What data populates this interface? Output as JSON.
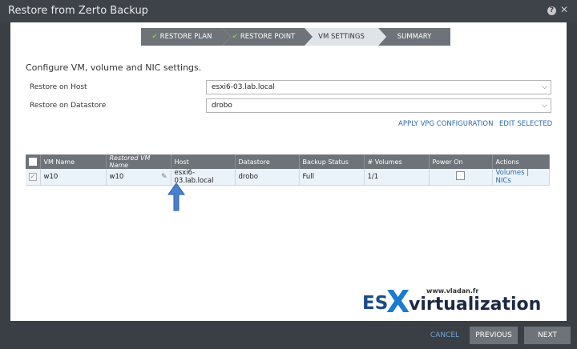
{
  "window": {
    "title": "Restore from Zerto Backup",
    "help_icon": "help-icon",
    "close_icon": "close-icon"
  },
  "wizard": {
    "steps": [
      {
        "label": "RESTORE PLAN",
        "state": "done"
      },
      {
        "label": "RESTORE POINT",
        "state": "done"
      },
      {
        "label": "VM SETTINGS",
        "state": "active"
      },
      {
        "label": "SUMMARY",
        "state": "todo"
      }
    ],
    "check_glyph": "✔"
  },
  "main": {
    "heading": "Configure VM, volume and NIC settings.",
    "restore_host_label": "Restore on Host",
    "restore_host_value": "esxi6-03.lab.local",
    "restore_datastore_label": "Restore on Datastore",
    "restore_datastore_value": "drobo",
    "apply_vpg_label": "APPLY VPG CONFIGURATION",
    "edit_selected_label": "EDIT SELECTED"
  },
  "table": {
    "columns": [
      "VM Name",
      "Restored VM Name",
      "Host",
      "Datastore",
      "Backup Status",
      "# Volumes",
      "Power On",
      "Actions"
    ],
    "rows": [
      {
        "vm_name": "w10",
        "restored_vm_name": "w10",
        "host": "esxi6-03.lab.local",
        "datastore": "drobo",
        "backup_status": "Full",
        "volumes": "1/1",
        "power_on": false,
        "action_volumes": "Volumes",
        "action_separator": "|",
        "action_nics": "NICs",
        "selected": true
      }
    ]
  },
  "footer": {
    "cancel_label": "CANCEL",
    "previous_label": "PREVIOUS",
    "next_label": "NEXT"
  },
  "watermark": {
    "url": "www.vladan.fr",
    "brand_es": "ES",
    "brand_x": "X",
    "brand_rest": "virtualization"
  },
  "colors": {
    "accent_blue": "#2a6aa8",
    "step_done": "#6d7378",
    "step_active": "#dfe4e8",
    "check_green": "#7fd14d",
    "annotation_arrow": "#4a7fd0"
  }
}
